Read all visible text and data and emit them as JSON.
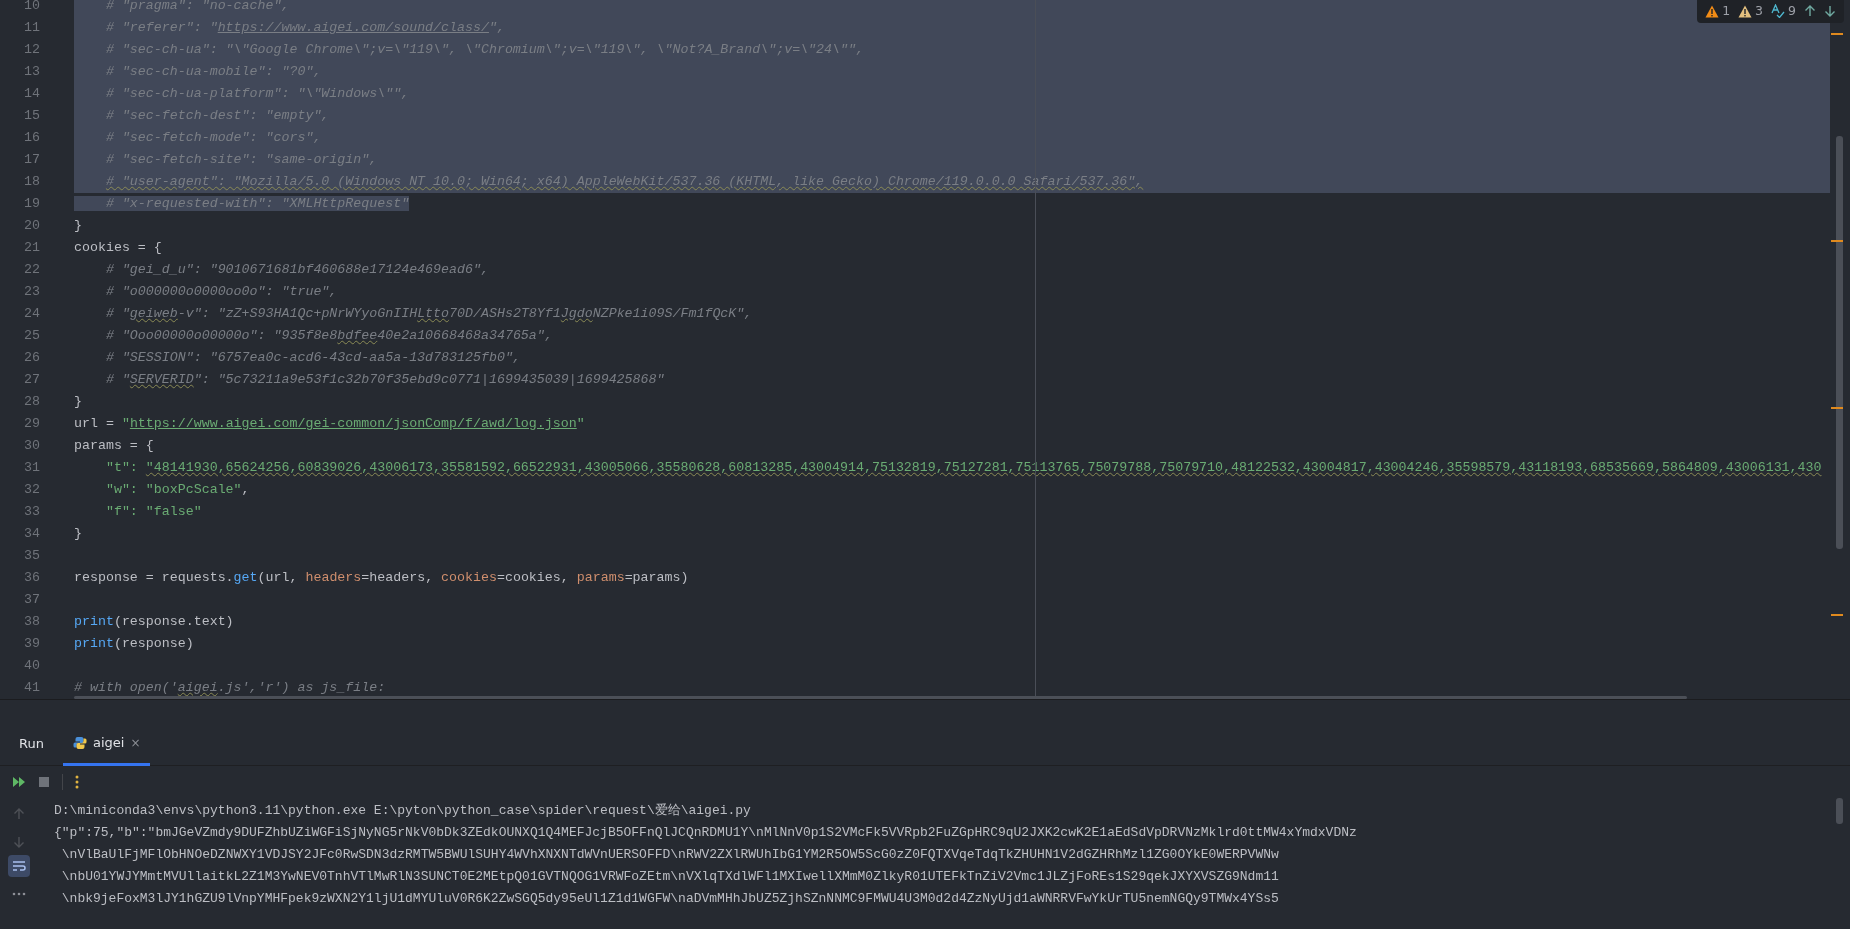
{
  "editor": {
    "lines": [
      {
        "number": "10",
        "selected": true,
        "tokens": [
          {
            "kind": "comment",
            "text": "    # \"pragma\": \"no-cache\","
          }
        ]
      },
      {
        "number": "11",
        "selected": true,
        "tokens": [
          {
            "kind": "comment",
            "text": "    # \"referer\": \""
          },
          {
            "kind": "comment-link",
            "text": "https://www.aigei.com/sound/class/"
          },
          {
            "kind": "comment",
            "text": "\","
          }
        ]
      },
      {
        "number": "12",
        "selected": true,
        "tokens": [
          {
            "kind": "comment",
            "text": "    # \"sec-ch-ua\": \"\\\"Google Chrome\\\";v=\\\"119\\\", \\\"Chromium\\\";v=\\\"119\\\", \\\"Not?A_Brand\\\";v=\\\"24\\\"\","
          }
        ]
      },
      {
        "number": "13",
        "selected": true,
        "tokens": [
          {
            "kind": "comment",
            "text": "    # \"sec-ch-ua-mobile\": \"?0\","
          }
        ]
      },
      {
        "number": "14",
        "selected": true,
        "tokens": [
          {
            "kind": "comment",
            "text": "    # \"sec-ch-ua-platform\": \"\\\"Windows\\\"\","
          }
        ]
      },
      {
        "number": "15",
        "selected": true,
        "tokens": [
          {
            "kind": "comment",
            "text": "    # \"sec-fetch-dest\": \"empty\","
          }
        ]
      },
      {
        "number": "16",
        "selected": true,
        "tokens": [
          {
            "kind": "comment",
            "text": "    # \"sec-fetch-mode\": \"cors\","
          }
        ]
      },
      {
        "number": "17",
        "selected": true,
        "tokens": [
          {
            "kind": "comment",
            "text": "    # \"sec-fetch-site\": \"same-origin\","
          }
        ]
      },
      {
        "number": "18",
        "selected": true,
        "tokens": [
          {
            "kind": "comment-typo",
            "text": "    # \"user-agent\": \"Mozilla/5.0 (Windows NT 10.0; Win64; x64) AppleWebKit/537.36 (KHTML, like Gecko) Chrome/119.0.0.0 Safari/537.36\","
          }
        ]
      },
      {
        "number": "19",
        "selected": true,
        "tokens": [
          {
            "kind": "comment",
            "text": "    # \"x-requested-with\": \"XMLHttpRequest\""
          }
        ]
      },
      {
        "number": "20",
        "selected": false,
        "tokens": [
          {
            "kind": "plain",
            "text": "}"
          }
        ]
      },
      {
        "number": "21",
        "selected": false,
        "tokens": [
          {
            "kind": "plain",
            "text": "cookies = {"
          }
        ]
      },
      {
        "number": "22",
        "selected": false,
        "tokens": [
          {
            "kind": "comment",
            "text": "    # \"gei_d_u\": \"9010671681bf460688e17124e469ead6\","
          }
        ]
      },
      {
        "number": "23",
        "selected": false,
        "tokens": [
          {
            "kind": "comment",
            "text": "    # \"o000000o0000oo0o\": \"true\","
          }
        ]
      },
      {
        "number": "24",
        "selected": false,
        "tokens": [
          {
            "kind": "comment",
            "text": "    # \""
          },
          {
            "kind": "comment-typo",
            "text": "geiweb"
          },
          {
            "kind": "comment",
            "text": "-v\": \"zZ+S93HA1Qc+pNrWYyoGnIIH"
          },
          {
            "kind": "comment-typo",
            "text": "Ltto"
          },
          {
            "kind": "comment",
            "text": "70D/ASHs2T8Yf1"
          },
          {
            "kind": "comment-typo",
            "text": "Jgdo"
          },
          {
            "kind": "comment",
            "text": "NZPke1i09S/Fm1fQcK\","
          }
        ]
      },
      {
        "number": "25",
        "selected": false,
        "tokens": [
          {
            "kind": "comment",
            "text": "    # \"Ooo00000o00000o\": \"935f8e8"
          },
          {
            "kind": "comment-typo",
            "text": "bdfee"
          },
          {
            "kind": "comment",
            "text": "40e2a10668468a34765a\","
          }
        ]
      },
      {
        "number": "26",
        "selected": false,
        "tokens": [
          {
            "kind": "comment",
            "text": "    # \"SESSION\": \"6757ea0c-acd6-43cd-aa5a-13d783125fb0\","
          }
        ]
      },
      {
        "number": "27",
        "selected": false,
        "tokens": [
          {
            "kind": "comment",
            "text": "    # \""
          },
          {
            "kind": "comment-typo",
            "text": "SERVERID"
          },
          {
            "kind": "comment",
            "text": "\": \"5c73211a9e53f1c32b70f35ebd9c0771|1699435039|1699425868\""
          }
        ]
      },
      {
        "number": "28",
        "selected": false,
        "tokens": [
          {
            "kind": "plain",
            "text": "}"
          }
        ]
      },
      {
        "number": "29",
        "selected": false,
        "tokens": [
          {
            "kind": "plain",
            "text": "url = "
          },
          {
            "kind": "string",
            "text": "\""
          },
          {
            "kind": "string-link",
            "text": "https://www.aigei.com/gei-common/jsonComp/f/awd/log.json"
          },
          {
            "kind": "string",
            "text": "\""
          }
        ]
      },
      {
        "number": "30",
        "selected": false,
        "tokens": [
          {
            "kind": "plain",
            "text": "params = {"
          }
        ]
      },
      {
        "number": "31",
        "selected": false,
        "tokens": [
          {
            "kind": "string",
            "text": "    \"t\": "
          },
          {
            "kind": "string-typo",
            "text": "\"48141930,65624256,60839026,43006173,35581592,66522931,43005066,35580628,60813285,43004914,75132819,75127281,75113765,75079788,75079710,48122532,43004817,43004246,35598579,43118193,68535669,5864809,43006131,430"
          }
        ]
      },
      {
        "number": "32",
        "selected": false,
        "tokens": [
          {
            "kind": "string",
            "text": "    \"w\": \"boxPcScale\""
          },
          {
            "kind": "plain",
            "text": ","
          }
        ]
      },
      {
        "number": "33",
        "selected": false,
        "tokens": [
          {
            "kind": "string",
            "text": "    \"f\": \"false\""
          }
        ]
      },
      {
        "number": "34",
        "selected": false,
        "tokens": [
          {
            "kind": "plain",
            "text": "}"
          }
        ]
      },
      {
        "number": "35",
        "selected": false
      },
      {
        "number": "36",
        "selected": false,
        "tokens": [
          {
            "kind": "plain",
            "text": "response = requests."
          },
          {
            "kind": "call",
            "text": "get"
          },
          {
            "kind": "plain",
            "text": "(url, "
          },
          {
            "kind": "param",
            "text": "headers"
          },
          {
            "kind": "plain",
            "text": "=headers, "
          },
          {
            "kind": "param",
            "text": "cookies"
          },
          {
            "kind": "plain",
            "text": "=cookies, "
          },
          {
            "kind": "param",
            "text": "params"
          },
          {
            "kind": "plain",
            "text": "=params)"
          }
        ]
      },
      {
        "number": "37",
        "selected": false
      },
      {
        "number": "38",
        "selected": false,
        "tokens": [
          {
            "kind": "call",
            "text": "print"
          },
          {
            "kind": "plain",
            "text": "(response.text)"
          }
        ]
      },
      {
        "number": "39",
        "selected": false,
        "tokens": [
          {
            "kind": "call",
            "text": "print"
          },
          {
            "kind": "plain",
            "text": "(response)"
          }
        ]
      },
      {
        "number": "40",
        "selected": false
      },
      {
        "number": "41",
        "selected": false,
        "tokens": [
          {
            "kind": "comment",
            "text": "# with open('"
          },
          {
            "kind": "comment-typo",
            "text": "aigei"
          },
          {
            "kind": "comment",
            "text": ".js','r') as js_file:"
          }
        ]
      }
    ],
    "inspections": [
      {
        "kind": "warning",
        "count": "1"
      },
      {
        "kind": "weak-warning",
        "count": "3"
      },
      {
        "kind": "typo",
        "count": "9"
      }
    ]
  },
  "run_panel": {
    "title": "Run",
    "tabs": [
      {
        "label": "aigei",
        "selected": true,
        "close": "×"
      }
    ],
    "output": [
      "D:\\miniconda3\\envs\\python3.11\\python.exe E:\\pyton\\python_case\\spider\\request\\爱给\\aigei.py",
      "{\"p\":75,\"b\":\"bmJGeVZmdy9DUFZhbUZiWGFiSjNyNG5rNkV0bDk3ZEdkOUNXQ1Q4MEFJcjB5OFFnQlJCQnRDMU1Y\\nMlNnV0p1S2VMcFk5VVRpb2FuZGpHRC9qU2JXK2cwK2E1aEdSdVpDRVNzMklrd0ttMW4xYmdxVDNz",
      " \\nVlBaUlFjMFlObHNOeDZNWXY1VDJSY2JFc0RwSDN3dzRMTW5BWUlSUHY4WVhXNXNTdWVnUERSOFFD\\nRWV2ZXlRWUhIbG1YM2R5OW5ScG0zZ0FQTXVqeTdqTkZHUHN1V2dGZHRhMzl1ZG0OYkE0WERPVWNw",
      " \\nbU01YWJYMmtMVUllaitkL2Z1M3YwNEV0TnhVTlMwRlN3SUNCT0E2MEtpQ01GVTNQOG1VRWFoZEtm\\nVXlqTXdlWFl1MXIwellXMmM0ZlkyR01UTEFkTnZiV2Vmc1JLZjFoREs1S29qekJXYXVSZG9Ndm11",
      " \\nbk9jeFoxM3lJY1hGZU9lVnpYMHFpek9zWXN2Y1ljU1dMYUluV0R6K2ZwSGQ5dy95eUl1Z1d1WGFW\\naDVmMHhJbUZ5ZjhSZnNNMC9FMWU4U3M0d2d4ZzNyUjd1aWNRRVFwYkUrTU5nemNGQy9TMWx4YSs5"
    ]
  }
}
